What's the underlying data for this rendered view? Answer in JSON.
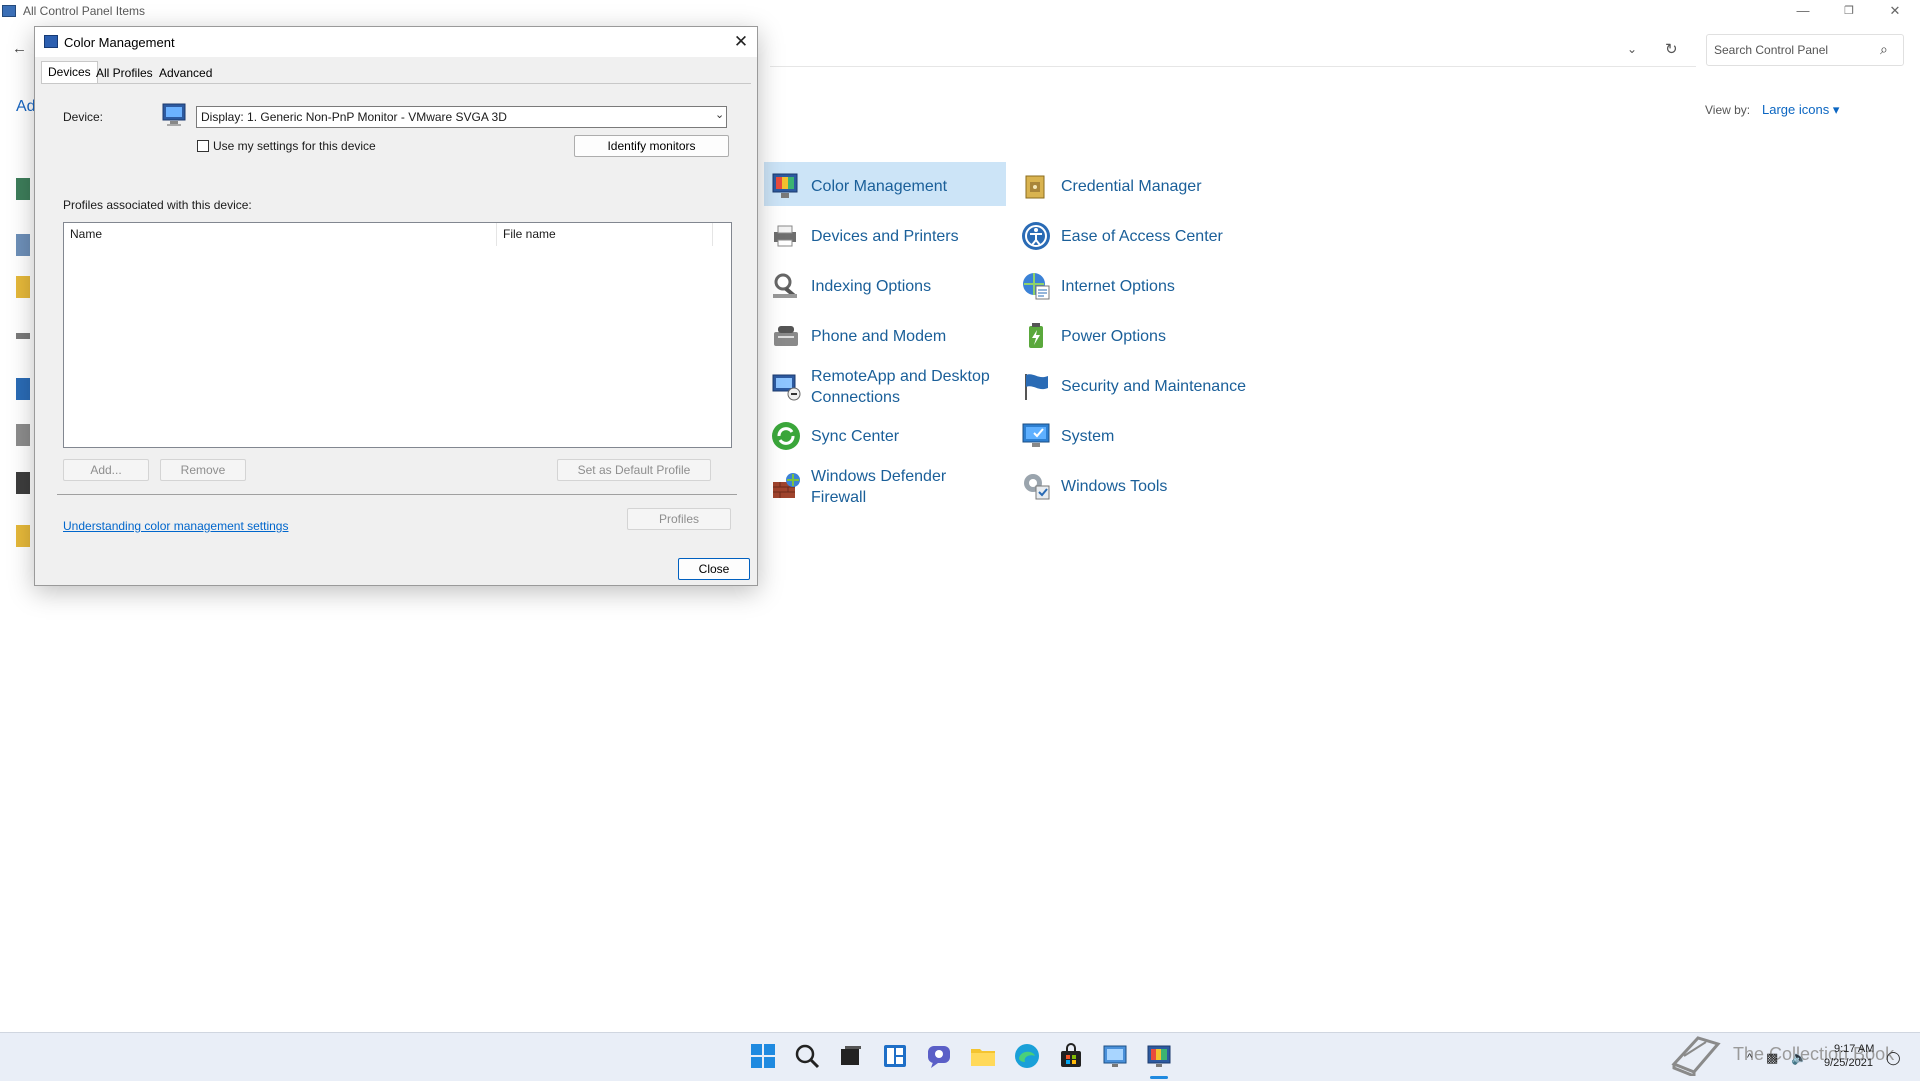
{
  "window": {
    "title": "All Control Panel Items",
    "minimize": "—",
    "restore": "❐",
    "close": "✕"
  },
  "nav": {
    "back": "←",
    "dropdown": "⌄",
    "refresh": "↻",
    "left_title_fragment": "Ad"
  },
  "search": {
    "placeholder": "Search Control Panel",
    "icon": "⌕"
  },
  "view_by": {
    "label": "View by:",
    "value": "Large icons ▾"
  },
  "items": [
    {
      "label": "Color Management",
      "icon": "color-management-icon"
    },
    {
      "label": "Credential Manager",
      "icon": "credential-manager-icon"
    },
    {
      "label": "Devices and Printers",
      "icon": "devices-printers-icon"
    },
    {
      "label": "Ease of Access Center",
      "icon": "ease-of-access-icon"
    },
    {
      "label": "Indexing Options",
      "icon": "indexing-options-icon"
    },
    {
      "label": "Internet Options",
      "icon": "internet-options-icon"
    },
    {
      "label": "Phone and Modem",
      "icon": "phone-modem-icon"
    },
    {
      "label": "Power Options",
      "icon": "power-options-icon"
    },
    {
      "label": "RemoteApp and Desktop",
      "label2": "Connections",
      "icon": "remoteapp-icon"
    },
    {
      "label": "Security and Maintenance",
      "icon": "security-maintenance-icon"
    },
    {
      "label": "Sync Center",
      "icon": "sync-center-icon"
    },
    {
      "label": "System",
      "icon": "system-icon"
    },
    {
      "label": "Windows Defender",
      "label2": "Firewall",
      "icon": "firewall-icon"
    },
    {
      "label": "Windows Tools",
      "icon": "windows-tools-icon"
    }
  ],
  "dialog": {
    "title": "Color Management",
    "close_glyph": "✕",
    "tabs": [
      "Devices",
      "All Profiles",
      "Advanced"
    ],
    "device_label": "Device:",
    "device_value": "Display: 1. Generic Non-PnP Monitor - VMware SVGA 3D",
    "dropdown_arrow": "⌄",
    "use_settings_label": "Use my settings for this device",
    "use_settings_checked": false,
    "identify_button": "Identify monitors",
    "profiles_label": "Profiles associated with this device:",
    "columns": [
      "Name",
      "File name"
    ],
    "rows": [],
    "add_button": "Add...",
    "remove_button": "Remove",
    "default_button": "Set as Default Profile",
    "profiles_button": "Profiles",
    "help_link": "Understanding color management settings",
    "close_button": "Close"
  },
  "tray": {
    "time": "9:17 AM",
    "date": "9/25/2021",
    "watermark": "The Collection Book"
  },
  "colors": {
    "accent": "#0b66c2",
    "link": "#0066cc",
    "selected_item": "#cce4f7",
    "taskbar": "#e9eef7"
  }
}
